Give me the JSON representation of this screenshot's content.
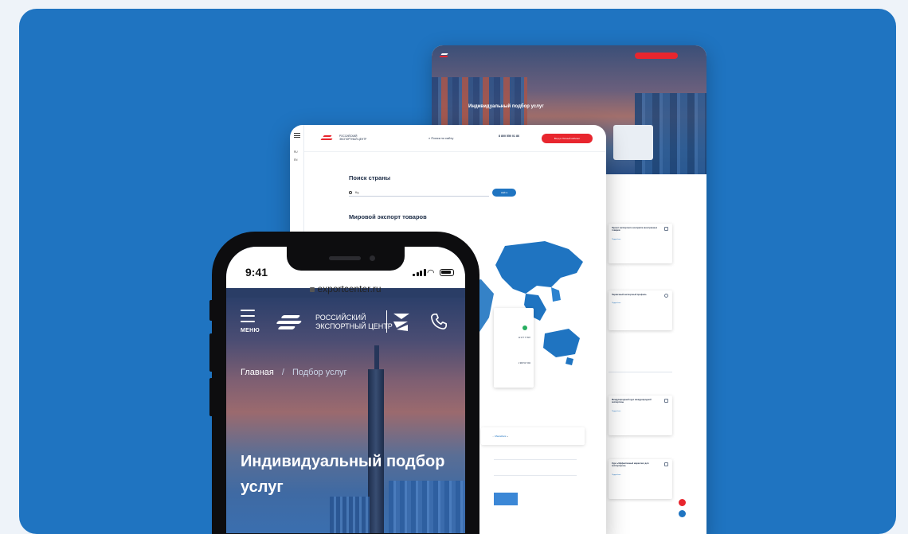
{
  "phone": {
    "status_time": "9:41",
    "url": "exportcenter.ru",
    "menu_label": "МЕНЮ",
    "logo_line1": "РОССИЙСКИЙ",
    "logo_line2": "ЭКСПОРТНЫЙ ЦЕНТР",
    "breadcrumb_home": "Главная",
    "breadcrumb_sep": "/",
    "breadcrumb_current": "Подбор услуг",
    "hero_title": "Индивидуальный подбор услуг"
  },
  "desktop_middle": {
    "search_label": "Поиск по сайту",
    "phone_number": "8 800 550 01 86",
    "cta_label": "Вход в Личный кабинет",
    "lang_ru": "RU",
    "lang_en": "EN",
    "page_heading": "Поиск страны",
    "search_value": "Ку,",
    "find_button": "Найти",
    "section_heading": "Мировой экспорт товаров",
    "popup_value_1": "12 477 77 807",
    "popup_value_2": "1 996 517 002",
    "filter_value": "Малайзия"
  },
  "desktop_back": {
    "hero_title": "Индивидуальный подбор услуг",
    "card_titles": [
      "Проект экспортного контракта иностранных товаров",
      "Первичный экспортный профиль",
      "Международный курс международной экспертизы",
      "Курс «Эффективный маркетинг для экспортеров»"
    ],
    "card_link": "Подробнее"
  },
  "colors": {
    "panel_blue": "#1f74c1",
    "accent_red": "#e8262e",
    "map_blue": "#1f74c1"
  }
}
